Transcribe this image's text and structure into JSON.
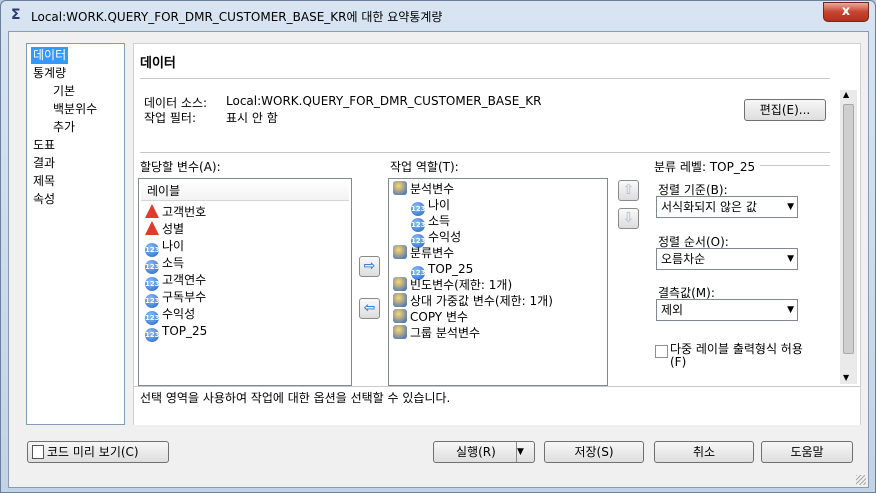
{
  "window": {
    "title": "Local:WORK.QUERY_FOR_DMR_CUSTOMER_BASE_KR에 대한 요약통계량",
    "title_icon": "Σ",
    "close_label": "x"
  },
  "nav": {
    "items": [
      {
        "label": "데이터",
        "selected": true
      },
      {
        "label": "통계량"
      },
      {
        "label": "기본"
      },
      {
        "label": "백분위수"
      },
      {
        "label": "추가"
      },
      {
        "label": "도표"
      },
      {
        "label": "결과"
      },
      {
        "label": "제목"
      },
      {
        "label": "속성"
      }
    ]
  },
  "section": {
    "title": "데이터",
    "source_label": "데이터 소스:",
    "source_value": "Local:WORK.QUERY_FOR_DMR_CUSTOMER_BASE_KR",
    "filter_label": "작업 필터:",
    "filter_value": "표시 안 함",
    "edit_button": "편집(E)..."
  },
  "variables": {
    "label": "할당할 변수(A):",
    "header": "레이블",
    "items": [
      {
        "name": "고객번호",
        "icon": "categorical-icon"
      },
      {
        "name": "성별",
        "icon": "categorical-icon"
      },
      {
        "name": "나이",
        "icon": "numeric-icon"
      },
      {
        "name": "소득",
        "icon": "numeric-icon"
      },
      {
        "name": "고객연수",
        "icon": "numeric-icon"
      },
      {
        "name": "구독부수",
        "icon": "numeric-icon"
      },
      {
        "name": "수익성",
        "icon": "numeric-icon"
      },
      {
        "name": "TOP_25",
        "icon": "numeric-icon"
      }
    ]
  },
  "roles": {
    "label": "작업 역할(T):",
    "items": [
      {
        "name": "분석변수",
        "level": 0,
        "icon": "role-icon"
      },
      {
        "name": "나이",
        "level": 1,
        "icon": "numeric-icon"
      },
      {
        "name": "소득",
        "level": 1,
        "icon": "numeric-icon"
      },
      {
        "name": "수익성",
        "level": 1,
        "icon": "numeric-icon"
      },
      {
        "name": "분류변수",
        "level": 0,
        "icon": "role-icon"
      },
      {
        "name": "TOP_25",
        "level": 1,
        "icon": "numeric-icon"
      },
      {
        "name": "빈도변수(제한: 1개)",
        "level": 0,
        "icon": "role-icon"
      },
      {
        "name": "상대 가중값 변수(제한: 1개)",
        "level": 0,
        "icon": "role-icon"
      },
      {
        "name": "COPY 변수",
        "level": 0,
        "icon": "role-icon"
      },
      {
        "name": "그룹 분석변수",
        "level": 0,
        "icon": "role-icon"
      }
    ]
  },
  "properties": {
    "title": "분류 레벨: TOP_25",
    "sort_by_label": "정렬 기준(B):",
    "sort_by_value": "서식화되지 않은 값",
    "sort_order_label": "정렬 순서(O):",
    "sort_order_value": "오름차순",
    "missing_label": "결측값(M):",
    "missing_value": "제외",
    "multilabel_label": "다중 레이블 출력형식 허용",
    "multilabel_hotkey": "(F)"
  },
  "description": "선택 영역을 사용하여 작업에 대한 옵션을 선택할 수 있습니다.",
  "footer": {
    "preview": "코드 미리 보기(C)",
    "run": "실행(R)",
    "save": "저장(S)",
    "cancel": "취소",
    "help": "도움말"
  }
}
